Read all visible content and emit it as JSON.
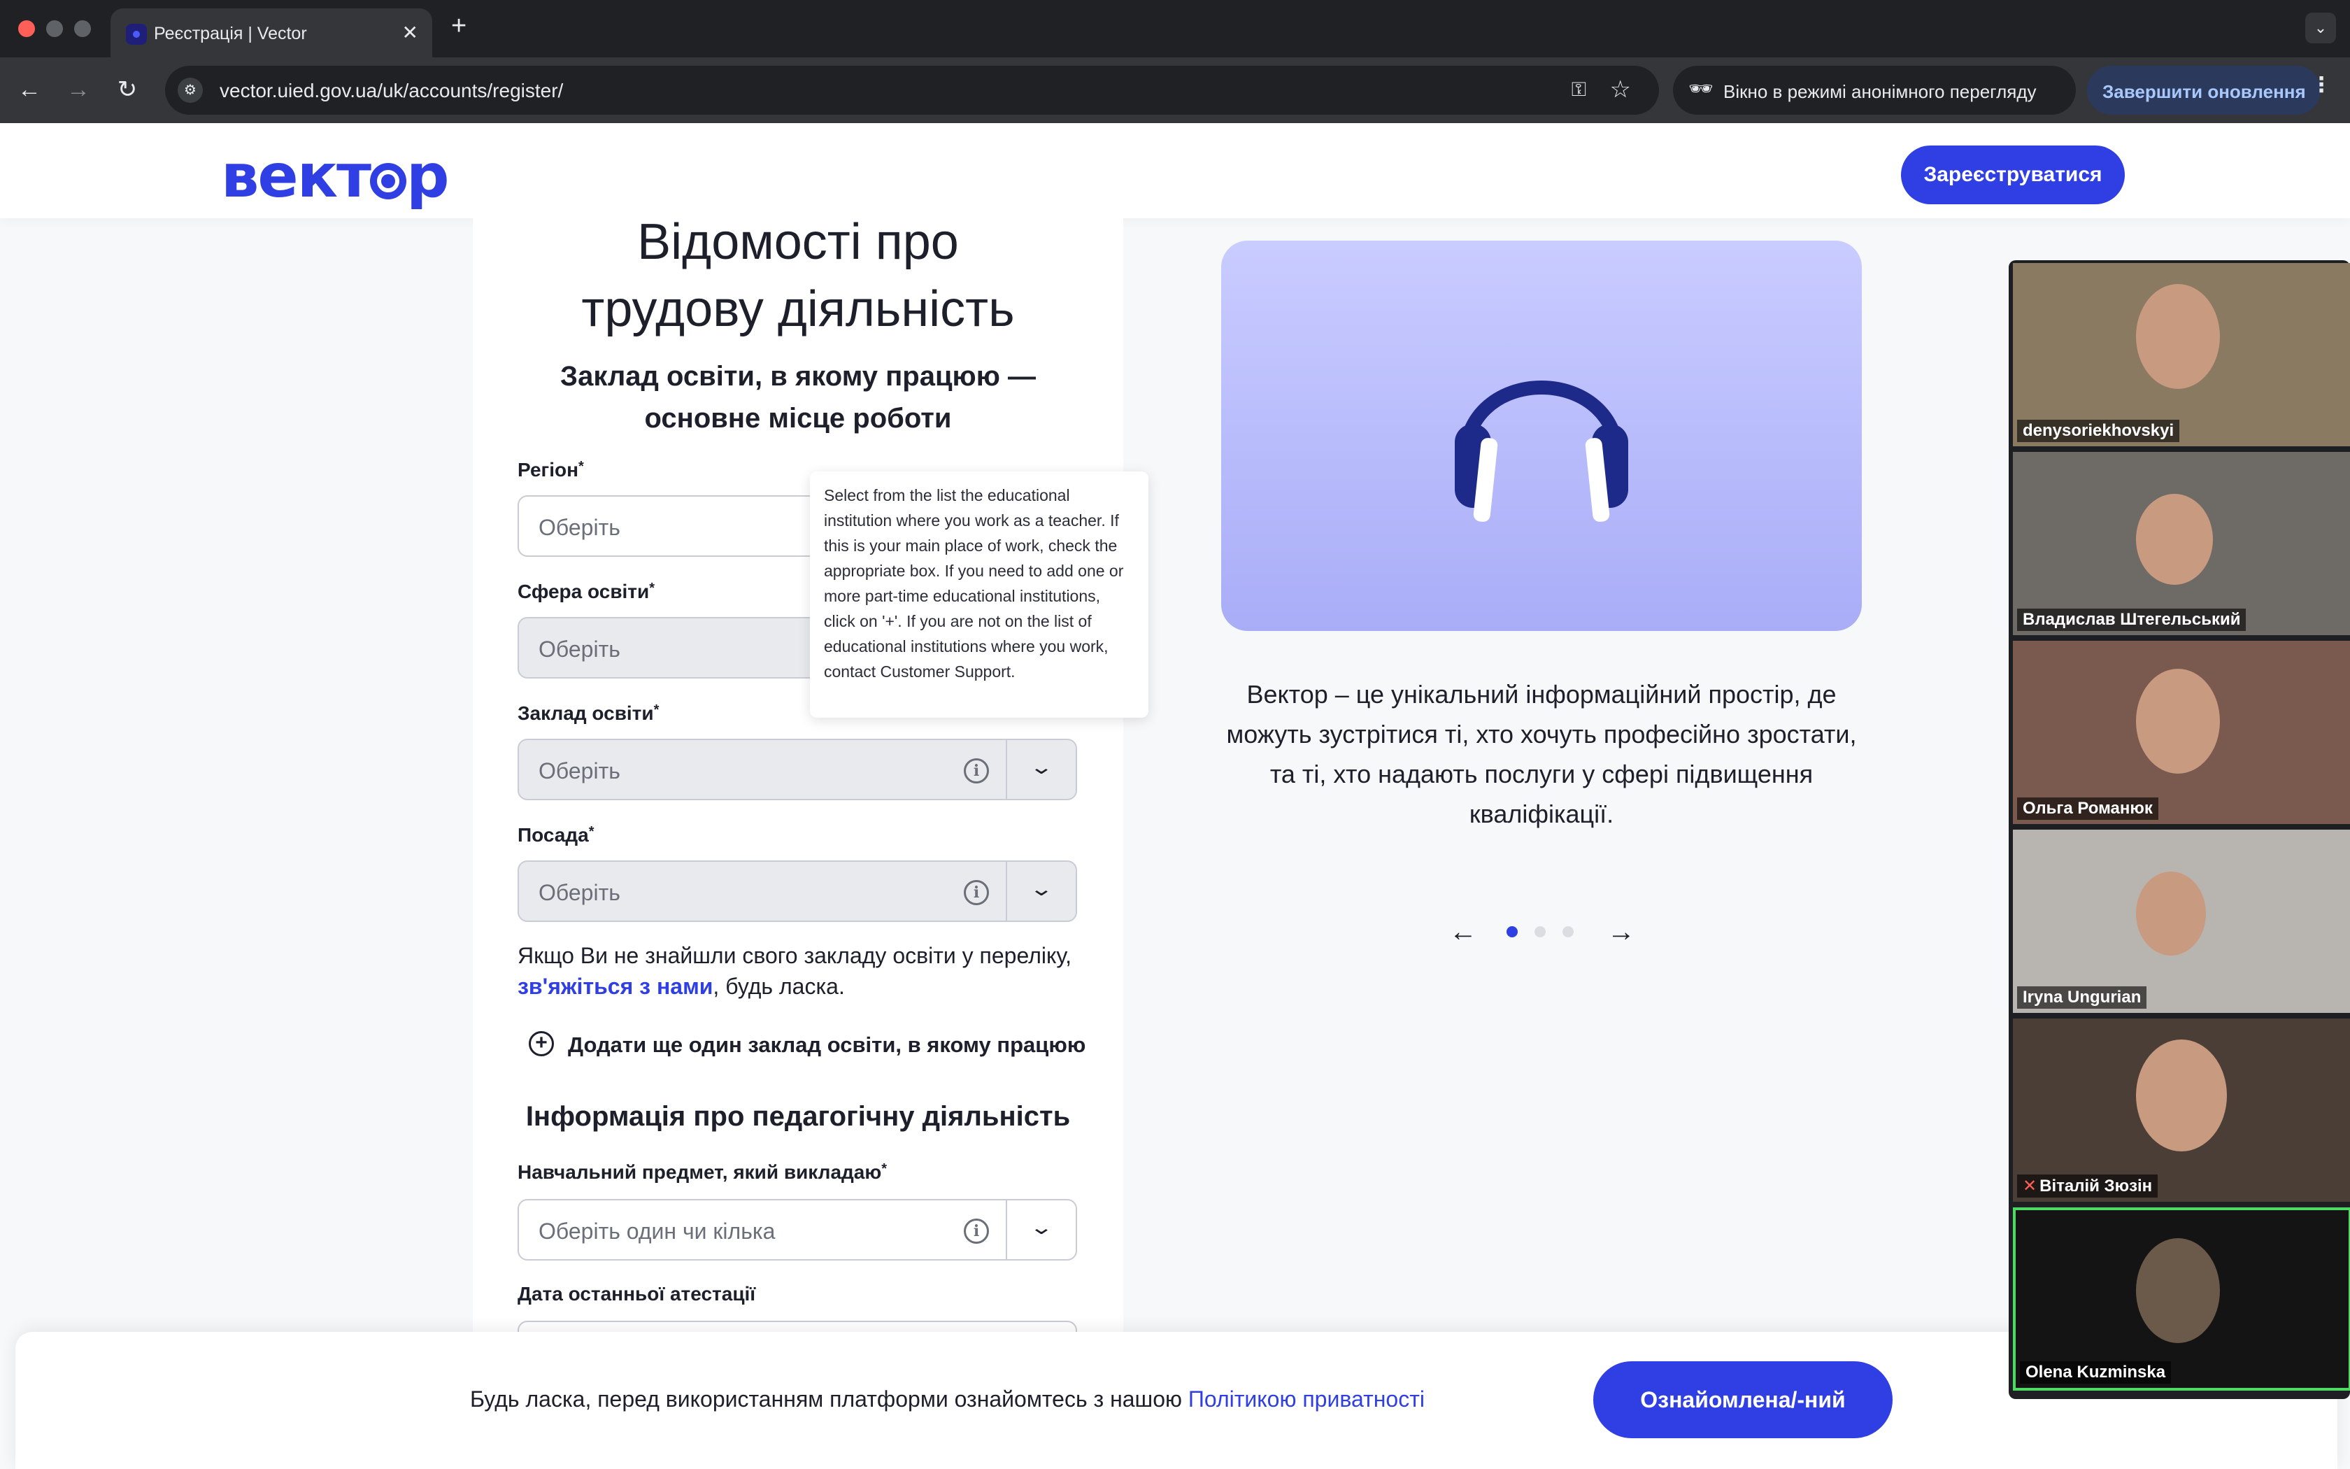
{
  "browser": {
    "tab_title": "Реєстрація | Vector",
    "url": "vector.uied.gov.ua/uk/accounts/register/",
    "incognito_label": "Вікно в режимі анонімного перегляду",
    "update_label": "Завершити оновлення"
  },
  "header": {
    "logo_prefix": "вект",
    "logo_suffix": "р",
    "register_button": "Зареєструватися"
  },
  "form": {
    "title_line1": "Відомості про",
    "title_line2": "трудову діяльність",
    "subtitle": "Заклад освіти, в якому працюю — основне місце роботи",
    "fields": [
      {
        "label": "Регіон",
        "placeholder": "Оберіть"
      },
      {
        "label": "Сфера освіти",
        "placeholder": "Оберіть"
      },
      {
        "label": "Заклад освіти",
        "placeholder": "Оберіть"
      },
      {
        "label": "Посада",
        "placeholder": "Оберіть"
      }
    ],
    "required_mark": "*",
    "note_before": "Якщо Ви не знайшли свого закладу освіти у переліку, ",
    "note_link": "зв'яжіться з нами",
    "note_after": ", будь ласка.",
    "add_institution": "Додати ще один заклад освіти, в якому працюю",
    "section2_title": "Інформація про педагогічну діяльність",
    "subject_label": "Навчальний предмет, який викладаю",
    "subject_placeholder": "Оберіть один чи кілька",
    "attestation_label": "Дата останньої атестації"
  },
  "tooltip": "Select from the list the educational institution where you work as a teacher. If this is your main place of work, check the appropriate box. If you need to add one or more part-time educational institutions, click on '+'. If you are not on the list of educational institutions where you work, contact Customer Support.",
  "promo": {
    "description": "Вектор – це унікальний інформаційний простір, де можуть зустрітися ті, хто хочуть професійно зростати, та ті, хто надають послуги у сфері підвищення кваліфікації.",
    "carousel_total": 3,
    "carousel_active": 1
  },
  "cookie": {
    "text": "Будь ласка, перед використанням платформи ознайомтесь з нашою ",
    "link": "Політикою приватності",
    "button": "Ознайомлена/-ний"
  },
  "video": {
    "participants": [
      {
        "name": "denysoriekhovskyi",
        "bg": "#8a7a62",
        "muted": false,
        "speaking": false
      },
      {
        "name": "Владислав Штегельський",
        "bg": "#6e6a66",
        "muted": false,
        "speaking": false
      },
      {
        "name": "Ольга Романюк",
        "bg": "#7a5a4e",
        "muted": false,
        "speaking": false
      },
      {
        "name": "Iryna Ungurian",
        "bg": "#b8b4b0",
        "muted": false,
        "speaking": false
      },
      {
        "name": "Віталій Зюзін",
        "bg": "#4a3e36",
        "muted": true,
        "speaking": false
      },
      {
        "name": "Olena Kuzminska",
        "bg": "#141414",
        "muted": false,
        "speaking": true
      }
    ]
  },
  "colors": {
    "brand": "#2f3fe3",
    "speaking_border": "#4cd964"
  }
}
